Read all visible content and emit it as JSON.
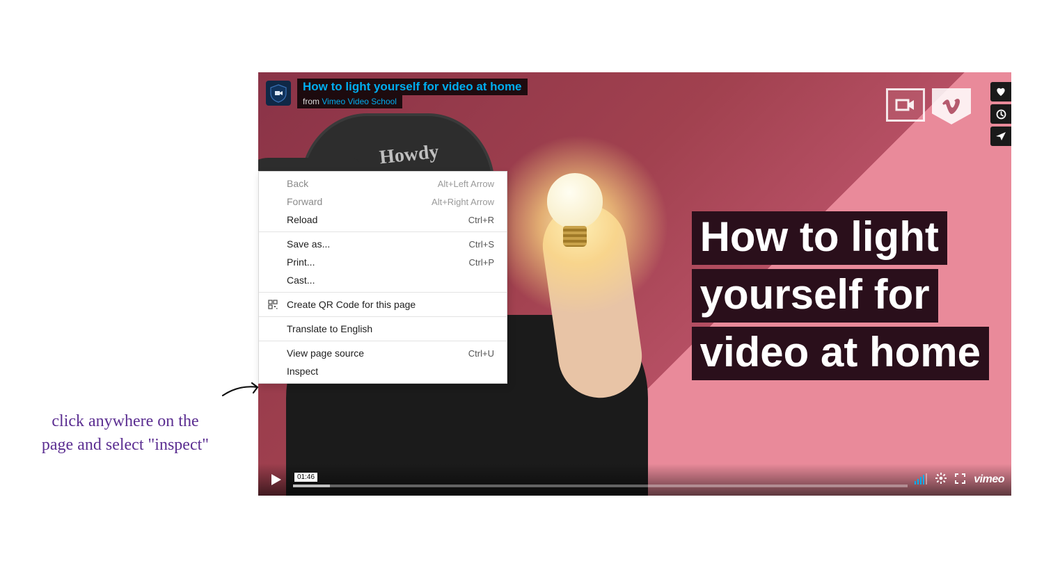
{
  "annotation": {
    "line1": "click anywhere on the",
    "line2": "page and select \"inspect\""
  },
  "video": {
    "title": "How to light yourself for video at home",
    "from_prefix": "from ",
    "channel": "Vimeo Video School",
    "thumb_title_l1": "How to light",
    "thumb_title_l2": "yourself for",
    "thumb_title_l3": "video at home",
    "cap_text": "Howdy",
    "current_time": "01:46",
    "vimeo_logo_text": "vimeo"
  },
  "context_menu": {
    "items": [
      {
        "label": "Back",
        "shortcut": "Alt+Left Arrow",
        "disabled": true,
        "sep_after": false,
        "icon": null
      },
      {
        "label": "Forward",
        "shortcut": "Alt+Right Arrow",
        "disabled": true,
        "sep_after": false,
        "icon": null
      },
      {
        "label": "Reload",
        "shortcut": "Ctrl+R",
        "disabled": false,
        "sep_after": true,
        "icon": null
      },
      {
        "label": "Save as...",
        "shortcut": "Ctrl+S",
        "disabled": false,
        "sep_after": false,
        "icon": null
      },
      {
        "label": "Print...",
        "shortcut": "Ctrl+P",
        "disabled": false,
        "sep_after": false,
        "icon": null
      },
      {
        "label": "Cast...",
        "shortcut": "",
        "disabled": false,
        "sep_after": true,
        "icon": null
      },
      {
        "label": "Create QR Code for this page",
        "shortcut": "",
        "disabled": false,
        "sep_after": true,
        "icon": "qr"
      },
      {
        "label": "Translate to English",
        "shortcut": "",
        "disabled": false,
        "sep_after": true,
        "icon": null
      },
      {
        "label": "View page source",
        "shortcut": "Ctrl+U",
        "disabled": false,
        "sep_after": false,
        "icon": null
      },
      {
        "label": "Inspect",
        "shortcut": "",
        "disabled": false,
        "sep_after": false,
        "icon": null
      }
    ]
  }
}
